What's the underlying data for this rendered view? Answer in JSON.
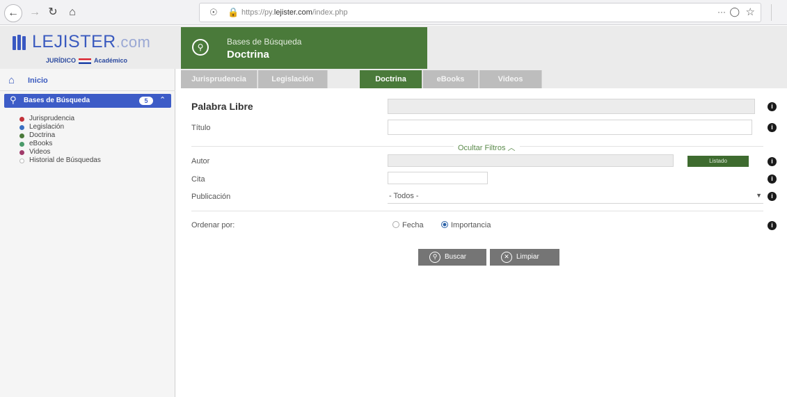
{
  "browser": {
    "url_prefix": "https://py.",
    "url_domain": "lejister.com",
    "url_path": "/index.php",
    "more_label": "···"
  },
  "brand": {
    "logo_main": "LEJISTER",
    "logo_tld": ".com",
    "logo_sub_left": "JURÍDICO",
    "logo_sub_right": "Académico"
  },
  "section": {
    "kicker": "Bases de Búsqueda",
    "title": "Doctrina"
  },
  "sidebar": {
    "home_label": "Inicio",
    "active_label": "Bases de Búsqueda",
    "active_badge": "5",
    "items": [
      {
        "label": "Jurisprudencia",
        "color": "#c2323a"
      },
      {
        "label": "Legislación",
        "color": "#3a6fc2"
      },
      {
        "label": "Doctrina",
        "color": "#4a7a3a"
      },
      {
        "label": "eBooks",
        "color": "#4a9a6a"
      },
      {
        "label": "Videos",
        "color": "#a03a6a"
      },
      {
        "label": "Historial de Búsquedas",
        "color": "#cccccc"
      }
    ]
  },
  "tabs": [
    "Jurisprudencia",
    "Legislación",
    "Doctrina",
    "eBooks",
    "Videos"
  ],
  "active_tab": "Doctrina",
  "form": {
    "palabra_libre_label": "Palabra Libre",
    "titulo_label": "Título",
    "filters_toggle": "Ocultar Filtros ︿",
    "autor_label": "Autor",
    "listado_button": "Listado",
    "cita_label": "Cita",
    "publicacion_label": "Publicación",
    "publicacion_value": "- Todos -",
    "ordenar_label": "Ordenar por:",
    "order_options": [
      {
        "label": "Fecha",
        "selected": false
      },
      {
        "label": "Importancia",
        "selected": true
      }
    ],
    "buscar_button": "Buscar",
    "limpiar_button": "Limpiar",
    "info_glyph": "i"
  },
  "colors": {
    "brand_blue": "#3d5cc7",
    "section_green": "#4a7a3a"
  }
}
